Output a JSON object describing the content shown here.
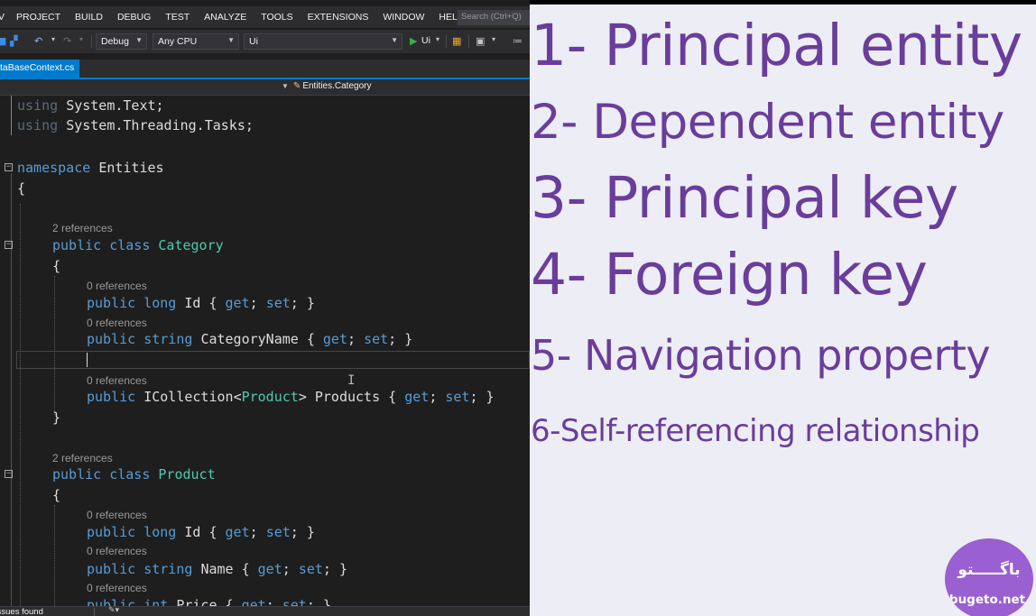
{
  "menu": {
    "items": [
      "V",
      "PROJECT",
      "BUILD",
      "DEBUG",
      "TEST",
      "ANALYZE",
      "TOOLS",
      "EXTENSIONS",
      "WINDOW",
      "HELP"
    ],
    "search_placeholder": "Search (Ctrl+Q)"
  },
  "toolbar": {
    "config": "Debug",
    "platform": "Any CPU",
    "project": "Ui",
    "run_label": "Ui"
  },
  "document_tab": {
    "title": "taBaseContext.cs"
  },
  "navigation": {
    "member": "Entities.Category"
  },
  "code": {
    "line_using_text": "System.Text;",
    "line_using_tasks": "System.Threading.Tasks;",
    "kw_using": "using",
    "kw_namespace": "namespace",
    "namespace_name": "Entities",
    "open_brace": "{",
    "close_brace": "}",
    "refs_2": "2 references",
    "refs_0": "0 references",
    "kw_public": "public",
    "kw_class": "class",
    "kw_long": "long",
    "kw_string": "string",
    "kw_int": "int",
    "class_category": "Category",
    "class_product": "Product",
    "prop_id": "Id",
    "prop_category_name": "CategoryName",
    "prop_name": "Name",
    "prop_price": "Price",
    "prop_products": "Products",
    "type_icollection": "ICollection",
    "accessor": "{ get; set; }",
    "kw_get": "get",
    "kw_set": "set"
  },
  "status": {
    "text": "Issues found"
  },
  "slide": {
    "lines": [
      "1- Principal entity",
      "2- Dependent entity",
      "3- Principal key",
      "4- Foreign key",
      "5- Navigation property",
      "6-Self-referencing relationship"
    ],
    "text_color": "#6a3d9b",
    "background": "#ededf5"
  },
  "logo": {
    "text_fa": "باگـــــتو",
    "text_en": "bugeto.net",
    "color": "#9a5fd1"
  }
}
